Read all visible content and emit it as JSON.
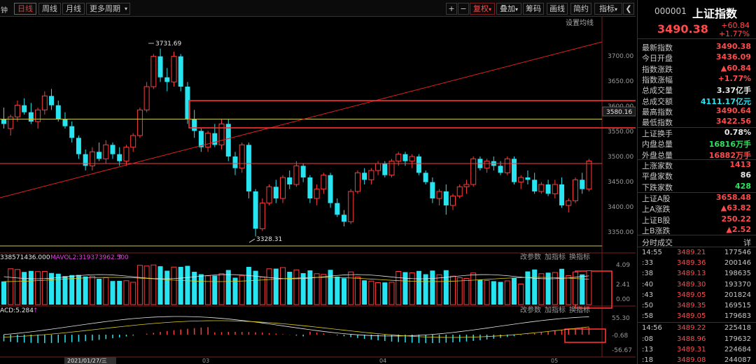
{
  "toolbar": {
    "left_cut": "钟",
    "tabs": [
      "日线",
      "周线",
      "月线",
      "更多周期"
    ],
    "right_buttons": [
      "复权",
      "叠加",
      "筹码",
      "画线",
      "简约",
      "指标"
    ],
    "colors": {
      "accent": "#e03c3c"
    }
  },
  "main_chart": {
    "set_ma": "设置均线",
    "price_axis": [
      "3700.00",
      "3650.00",
      "3600.00",
      "3550.00",
      "3500.00",
      "3450.00",
      "3400.00",
      "3350.00"
    ],
    "current_price_tag": "3580.16",
    "high_label": "3731.69",
    "low_label": "3328.31"
  },
  "volume_panel": {
    "legend_vol": "338571436.000",
    "legend_ma": "MAVOL2:319373962.500",
    "buttons": [
      "改参数",
      "加指标",
      "换指标"
    ],
    "axis": [
      "4.09",
      "2.41",
      "0.00"
    ]
  },
  "macd_panel": {
    "legend": "ACD:5.284",
    "buttons": [
      "改参数",
      "加指标",
      "换指标"
    ],
    "axis": [
      "55.30",
      "-0.68",
      "-56.67"
    ]
  },
  "date_axis": {
    "first_date": "2021/01/27/三",
    "months": [
      "03",
      "04",
      "05"
    ]
  },
  "chart_data": {
    "type": "candlestick",
    "title": "",
    "ylim": [
      3320,
      3740
    ],
    "high": 3731.69,
    "low": 3328.31,
    "current": 3580.16,
    "ohlc": [
      [
        3580,
        3605,
        3560,
        3570
      ],
      [
        3560,
        3590,
        3545,
        3585
      ],
      [
        3585,
        3620,
        3575,
        3610
      ],
      [
        3610,
        3625,
        3590,
        3595
      ],
      [
        3595,
        3615,
        3570,
        3575
      ],
      [
        3575,
        3605,
        3560,
        3600
      ],
      [
        3600,
        3640,
        3590,
        3630
      ],
      [
        3630,
        3645,
        3600,
        3610
      ],
      [
        3610,
        3620,
        3575,
        3580
      ],
      [
        3580,
        3595,
        3560,
        3565
      ],
      [
        3565,
        3575,
        3530,
        3540
      ],
      [
        3540,
        3545,
        3495,
        3505
      ],
      [
        3505,
        3515,
        3470,
        3480
      ],
      [
        3480,
        3520,
        3470,
        3510
      ],
      [
        3510,
        3530,
        3490,
        3495
      ],
      [
        3495,
        3535,
        3485,
        3525
      ],
      [
        3525,
        3530,
        3495,
        3505
      ],
      [
        3505,
        3520,
        3480,
        3490
      ],
      [
        3490,
        3525,
        3480,
        3520
      ],
      [
        3520,
        3550,
        3510,
        3545
      ],
      [
        3545,
        3605,
        3540,
        3600
      ],
      [
        3600,
        3660,
        3595,
        3650
      ],
      [
        3650,
        3720,
        3645,
        3715
      ],
      [
        3715,
        3731.69,
        3660,
        3670
      ],
      [
        3670,
        3690,
        3640,
        3660
      ],
      [
        3660,
        3725,
        3650,
        3715
      ],
      [
        3715,
        3720,
        3640,
        3650
      ],
      [
        3650,
        3660,
        3570,
        3580
      ],
      [
        3580,
        3600,
        3540,
        3555
      ],
      [
        3555,
        3560,
        3510,
        3520
      ],
      [
        3520,
        3555,
        3510,
        3550
      ],
      [
        3550,
        3570,
        3520,
        3525
      ],
      [
        3525,
        3580,
        3515,
        3570
      ],
      [
        3570,
        3580,
        3490,
        3500
      ],
      [
        3500,
        3510,
        3460,
        3475
      ],
      [
        3475,
        3530,
        3465,
        3525
      ],
      [
        3525,
        3530,
        3410,
        3425
      ],
      [
        3425,
        3430,
        3328.31,
        3345
      ],
      [
        3345,
        3410,
        3340,
        3400
      ],
      [
        3400,
        3440,
        3395,
        3435
      ],
      [
        3435,
        3450,
        3400,
        3410
      ],
      [
        3410,
        3460,
        3400,
        3455
      ],
      [
        3455,
        3470,
        3430,
        3440
      ],
      [
        3440,
        3490,
        3435,
        3480
      ],
      [
        3480,
        3485,
        3445,
        3455
      ],
      [
        3455,
        3460,
        3400,
        3410
      ],
      [
        3410,
        3440,
        3395,
        3430
      ],
      [
        3430,
        3465,
        3420,
        3460
      ],
      [
        3460,
        3465,
        3390,
        3400
      ],
      [
        3400,
        3410,
        3370,
        3375
      ],
      [
        3375,
        3385,
        3350,
        3360
      ],
      [
        3360,
        3430,
        3355,
        3425
      ],
      [
        3425,
        3470,
        3420,
        3465
      ],
      [
        3465,
        3475,
        3440,
        3450
      ],
      [
        3450,
        3475,
        3440,
        3470
      ],
      [
        3470,
        3490,
        3460,
        3485
      ],
      [
        3485,
        3490,
        3455,
        3460
      ],
      [
        3460,
        3495,
        3455,
        3490
      ],
      [
        3490,
        3510,
        3480,
        3505
      ],
      [
        3505,
        3510,
        3480,
        3490
      ],
      [
        3490,
        3505,
        3475,
        3500
      ],
      [
        3500,
        3505,
        3460,
        3465
      ],
      [
        3465,
        3470,
        3440,
        3445
      ],
      [
        3445,
        3455,
        3400,
        3410
      ],
      [
        3410,
        3430,
        3395,
        3425
      ],
      [
        3425,
        3440,
        3375,
        3395
      ],
      [
        3395,
        3420,
        3385,
        3415
      ],
      [
        3415,
        3440,
        3410,
        3435
      ],
      [
        3435,
        3450,
        3420,
        3440
      ],
      [
        3440,
        3500,
        3435,
        3495
      ],
      [
        3495,
        3500,
        3470,
        3475
      ],
      [
        3475,
        3495,
        3465,
        3490
      ],
      [
        3490,
        3500,
        3470,
        3480
      ],
      [
        3480,
        3490,
        3460,
        3465
      ],
      [
        3465,
        3500,
        3460,
        3495
      ],
      [
        3495,
        3500,
        3440,
        3445
      ],
      [
        3445,
        3460,
        3430,
        3455
      ],
      [
        3455,
        3470,
        3440,
        3450
      ],
      [
        3450,
        3465,
        3420,
        3425
      ],
      [
        3425,
        3445,
        3420,
        3440
      ],
      [
        3440,
        3450,
        3415,
        3420
      ],
      [
        3420,
        3450,
        3410,
        3440
      ],
      [
        3440,
        3455,
        3390,
        3395
      ],
      [
        3395,
        3410,
        3380,
        3405
      ],
      [
        3405,
        3455,
        3400,
        3450
      ],
      [
        3450,
        3465,
        3420,
        3430
      ],
      [
        3430,
        3495,
        3425,
        3490.38
      ]
    ]
  },
  "quote": {
    "code": "000001",
    "name": "上证指数",
    "price": "3490.38",
    "change": "+60.84",
    "change_pct": "+1.77%",
    "rows1": [
      {
        "label": "最新指数",
        "value": "3490.38",
        "color": "#ff4b4b"
      },
      {
        "label": "今日开盘",
        "value": "3436.09",
        "color": "#ff4b4b"
      },
      {
        "label": "指数涨跌",
        "value": "▲60.84",
        "color": "#ff4b4b"
      },
      {
        "label": "指数涨幅",
        "value": "+1.77%",
        "color": "#ff4b4b"
      },
      {
        "label": "总成交量",
        "value": "3.37亿手",
        "color": "#e8e8e8"
      },
      {
        "label": "总成交额",
        "value": "4111.17亿元",
        "color": "#27e4f0"
      },
      {
        "label": "最高指数",
        "value": "3490.64",
        "color": "#ff4b4b"
      },
      {
        "label": "最低指数",
        "value": "3422.56",
        "color": "#ff4b4b"
      }
    ],
    "rows2": [
      {
        "label": "上证换手",
        "value": "0.78%",
        "color": "#e8e8e8"
      },
      {
        "label": "内盘总量",
        "value": "16816万手",
        "color": "#27e45a"
      },
      {
        "label": "外盘总量",
        "value": "16882万手",
        "color": "#ff4b4b"
      }
    ],
    "rows3": [
      {
        "label": "上涨家数",
        "value": "1413",
        "color": "#ff4b4b"
      },
      {
        "label": "平盘家数",
        "value": "86",
        "color": "#e8e8e8"
      },
      {
        "label": "下跌家数",
        "value": "428",
        "color": "#27e45a"
      }
    ],
    "rows4": [
      {
        "label": "上证A股",
        "value": "3658.48",
        "color": "#ff4b4b"
      },
      {
        "label": "上A涨跌",
        "value": "▲63.82",
        "color": "#ff4b4b"
      },
      {
        "label": "上证B股",
        "value": "250.22",
        "color": "#ff4b4b"
      },
      {
        "label": "上B涨跌",
        "value": "▲2.52",
        "color": "#ff4b4b"
      }
    ],
    "ticks_title": "分时成交",
    "ticks_detail": "详",
    "ticks": [
      {
        "t": "14:55",
        "p": "3489.21",
        "v": "177546"
      },
      {
        "t": ":33",
        "p": "3489.36",
        "v": "200146"
      },
      {
        "t": ":38",
        "p": "3489.13",
        "v": "198635"
      },
      {
        "t": ":40",
        "p": "3489.30",
        "v": "193370"
      },
      {
        "t": ":43",
        "p": "3489.05",
        "v": "201824"
      },
      {
        "t": ":50",
        "p": "3489.35",
        "v": "169515"
      },
      {
        "t": ":58",
        "p": "3489.05",
        "v": "179683"
      },
      {
        "t": "14:56",
        "p": "3489.22",
        "v": "225418"
      },
      {
        "t": ":08",
        "p": "3488.96",
        "v": "179632"
      },
      {
        "t": ":13",
        "p": "3489.31",
        "v": "224684"
      },
      {
        "t": ":18",
        "p": "3489.08",
        "v": "244087"
      }
    ]
  }
}
